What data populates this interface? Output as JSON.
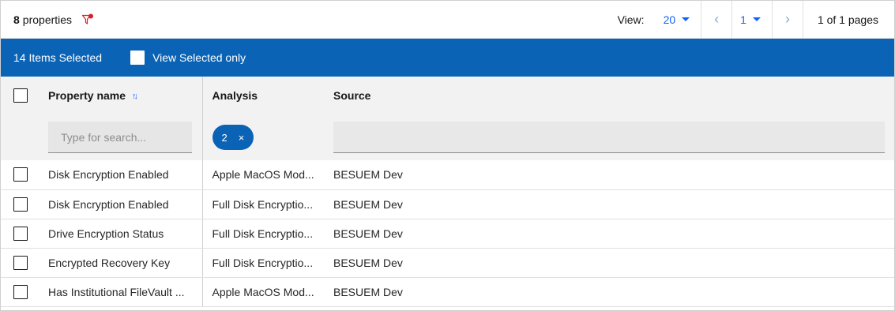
{
  "toolbar": {
    "count_number": "8",
    "count_label": "properties",
    "view_label": "View:",
    "page_size": "20",
    "current_page": "1",
    "pages_text": "1 of 1 pages",
    "prev_glyph": "‹",
    "next_glyph": "›"
  },
  "selection": {
    "count_text": "14 Items Selected",
    "view_selected_label": "View Selected only"
  },
  "table": {
    "headers": {
      "property_name": "Property name",
      "analysis": "Analysis",
      "source": "Source"
    },
    "filters": {
      "search_placeholder": "Type for search...",
      "analysis_pill_count": "2",
      "analysis_pill_close": "×"
    },
    "rows": [
      {
        "property_name": "Disk Encryption Enabled",
        "analysis": "Apple MacOS Mod...",
        "source": "BESUEM Dev"
      },
      {
        "property_name": "Disk Encryption Enabled",
        "analysis": "Full Disk Encryptio...",
        "source": "BESUEM Dev"
      },
      {
        "property_name": "Drive Encryption Status",
        "analysis": "Full Disk Encryptio...",
        "source": "BESUEM Dev"
      },
      {
        "property_name": "Encrypted Recovery Key",
        "analysis": "Full Disk Encryptio...",
        "source": "BESUEM Dev"
      },
      {
        "property_name": "Has Institutional FileVault ...",
        "analysis": "Apple MacOS Mod...",
        "source": "BESUEM Dev"
      }
    ]
  },
  "colors": {
    "accent": "#0f62fe",
    "selection_bar": "#0b63b6",
    "filter_icon": "#da1e28"
  },
  "icons": {
    "filter": "filter-remove-icon",
    "sort": "sort-icon",
    "prev": "chevron-left-icon",
    "next": "chevron-right-icon",
    "caret": "caret-down-icon"
  }
}
